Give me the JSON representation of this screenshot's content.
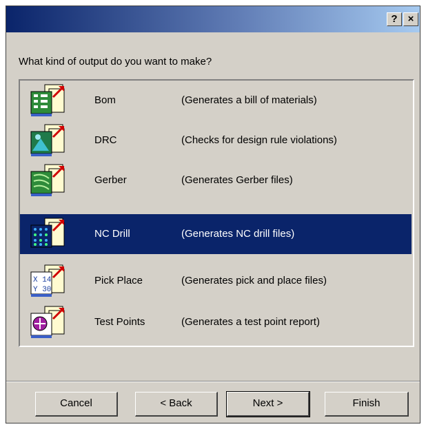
{
  "titlebar": {
    "help_label": "?",
    "close_label": "×"
  },
  "prompt": "What kind of output do you want to make?",
  "items": [
    {
      "name": "Bom",
      "description": "(Generates a bill of materials)",
      "icon": "bom-icon"
    },
    {
      "name": "DRC",
      "description": "(Checks for design rule violations)",
      "icon": "drc-icon"
    },
    {
      "name": "Gerber",
      "description": "(Generates Gerber files)",
      "icon": "gerber-icon"
    },
    {
      "name": "NC Drill",
      "description": "(Generates NC drill files)",
      "icon": "nc-drill-icon",
      "selected": true
    },
    {
      "name": "Pick Place",
      "description": "(Generates pick and place files)",
      "icon": "pick-place-icon"
    },
    {
      "name": "Test Points",
      "description": "(Generates a test point report)",
      "icon": "test-points-icon"
    }
  ],
  "buttons": {
    "cancel": "Cancel",
    "back": "< Back",
    "next": "Next >",
    "finish": "Finish"
  },
  "colors": {
    "selection": "#0a246a",
    "face": "#d4d0c8"
  }
}
